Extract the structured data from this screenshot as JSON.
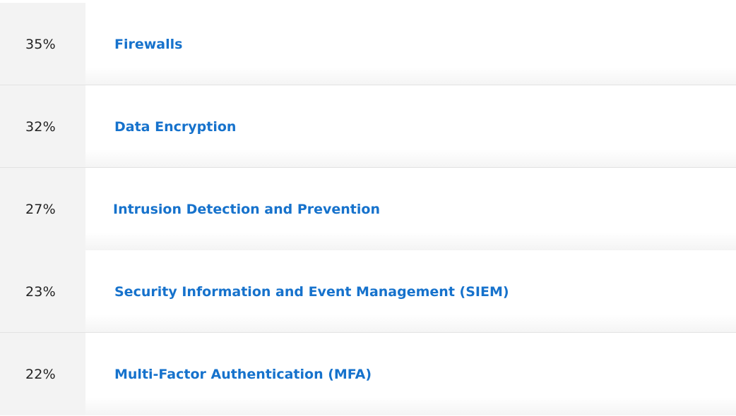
{
  "items": [
    {
      "percent": "35%",
      "label": "Firewalls"
    },
    {
      "percent": "32%",
      "label": "Data Encryption"
    },
    {
      "percent": "27%",
      "label": "Intrusion Detection and Prevention"
    },
    {
      "percent": "23%",
      "label": "Security Information and Event Management (SIEM)"
    },
    {
      "percent": "22%",
      "label": "Multi-Factor Authentication (MFA)"
    }
  ],
  "colors": {
    "link": "#1672cc",
    "percent_text": "#222222",
    "percent_cell_bg": "#f3f3f3",
    "divider": "#e2e2e2"
  }
}
